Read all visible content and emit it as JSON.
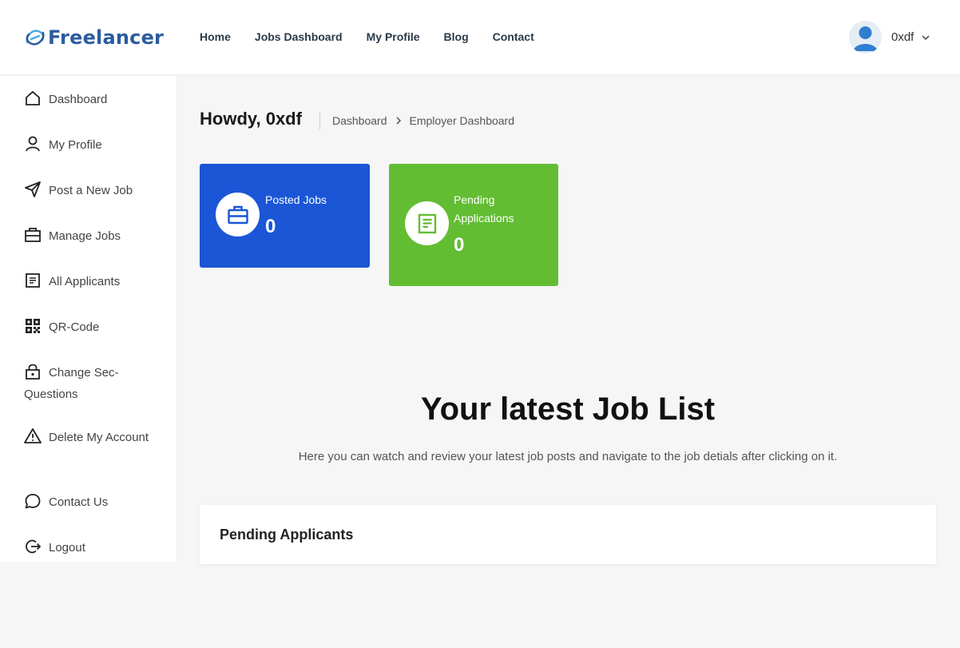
{
  "brand": {
    "name": "Freelancer",
    "color": "#2b5c9e"
  },
  "nav": {
    "items": [
      "Home",
      "Jobs Dashboard",
      "My Profile",
      "Blog",
      "Contact"
    ]
  },
  "user": {
    "name": "0xdf",
    "icon": "user-avatar-icon"
  },
  "sidebar": {
    "items": [
      {
        "label": "Dashboard",
        "icon": "home-icon"
      },
      {
        "label": "My Profile",
        "icon": "user-icon"
      },
      {
        "label": "Post a New Job",
        "icon": "send-icon"
      },
      {
        "label": "Manage Jobs",
        "icon": "briefcase-icon"
      },
      {
        "label": "All Applicants",
        "icon": "document-icon"
      },
      {
        "label": "QR-Code",
        "icon": "qr-code-icon"
      },
      {
        "label": "Change Sec-Questions",
        "icon": "lock-icon"
      },
      {
        "label": "Delete My Account",
        "icon": "warning-icon"
      },
      {
        "label": "Contact Us",
        "icon": "chat-icon"
      },
      {
        "label": "Logout",
        "icon": "logout-icon"
      }
    ]
  },
  "page": {
    "greeting": "Howdy, 0xdf",
    "breadcrumb": [
      "Dashboard",
      "Employer Dashboard"
    ]
  },
  "cards": {
    "posted": {
      "label": "Posted Jobs",
      "value": "0",
      "color": "#1a56d6",
      "icon": "briefcase-icon"
    },
    "pending": {
      "label": "Pending Applications",
      "value": "0",
      "color": "#62bd33",
      "icon": "document-icon"
    }
  },
  "latest": {
    "title": "Your latest Job List",
    "subtitle": "Here you can watch and review your latest job posts and navigate to the job detials after clicking on it."
  },
  "panel": {
    "title": "Pending Applicants"
  }
}
